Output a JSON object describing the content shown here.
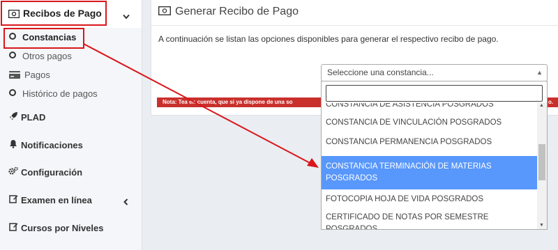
{
  "sidebar": {
    "menu_header": "Recibos de Pago",
    "sub_items": [
      {
        "label": "Constancias",
        "active": true
      },
      {
        "label": "Otros pagos"
      },
      {
        "label": "Pagos"
      },
      {
        "label": "Histórico de pagos"
      }
    ],
    "nav_items": [
      {
        "label": "PLAD",
        "icon": "rocket-icon"
      },
      {
        "label": "Notificaciones",
        "icon": "bell-icon"
      },
      {
        "label": "Configuración",
        "icon": "gears-icon"
      },
      {
        "label": "Examen en línea",
        "icon": "edit-icon"
      },
      {
        "label": "Cursos por Niveles",
        "icon": "edit-icon"
      }
    ]
  },
  "panel": {
    "title": "Generar Recibo de Pago",
    "description": "A continuación se listan las opciones disponibles para generar el respectivo recibo de pago.",
    "note_start": "Nota: Te",
    "note_middle": "a en cuenta, que si ya dispone de una so",
    "note_end": "o."
  },
  "select": {
    "placeholder": "Seleccione una constancia...",
    "search_value": "",
    "options": [
      "CONSTANCIA DE ASISTENCIA POSGRADOS",
      "CONSTANCIA DE VINCULACIÓN POSGRADOS",
      "CONSTANCIA PERMANENCIA POSGRADOS",
      "CONSTANCIA TERMINACIÓN DE MATERIAS POSGRADOS",
      "FOTOCOPIA HOJA DE VIDA POSGRADOS",
      "CERTIFICADO DE NOTAS POR SEMESTRE POSGRADOS"
    ],
    "highlighted": "CONSTANCIA TERMINACIÓN DE MATERIAS POSGRADOS"
  },
  "colors": {
    "annotation": "#d9161b",
    "highlight": "#5897fb",
    "note_bar": "#c9302c"
  }
}
